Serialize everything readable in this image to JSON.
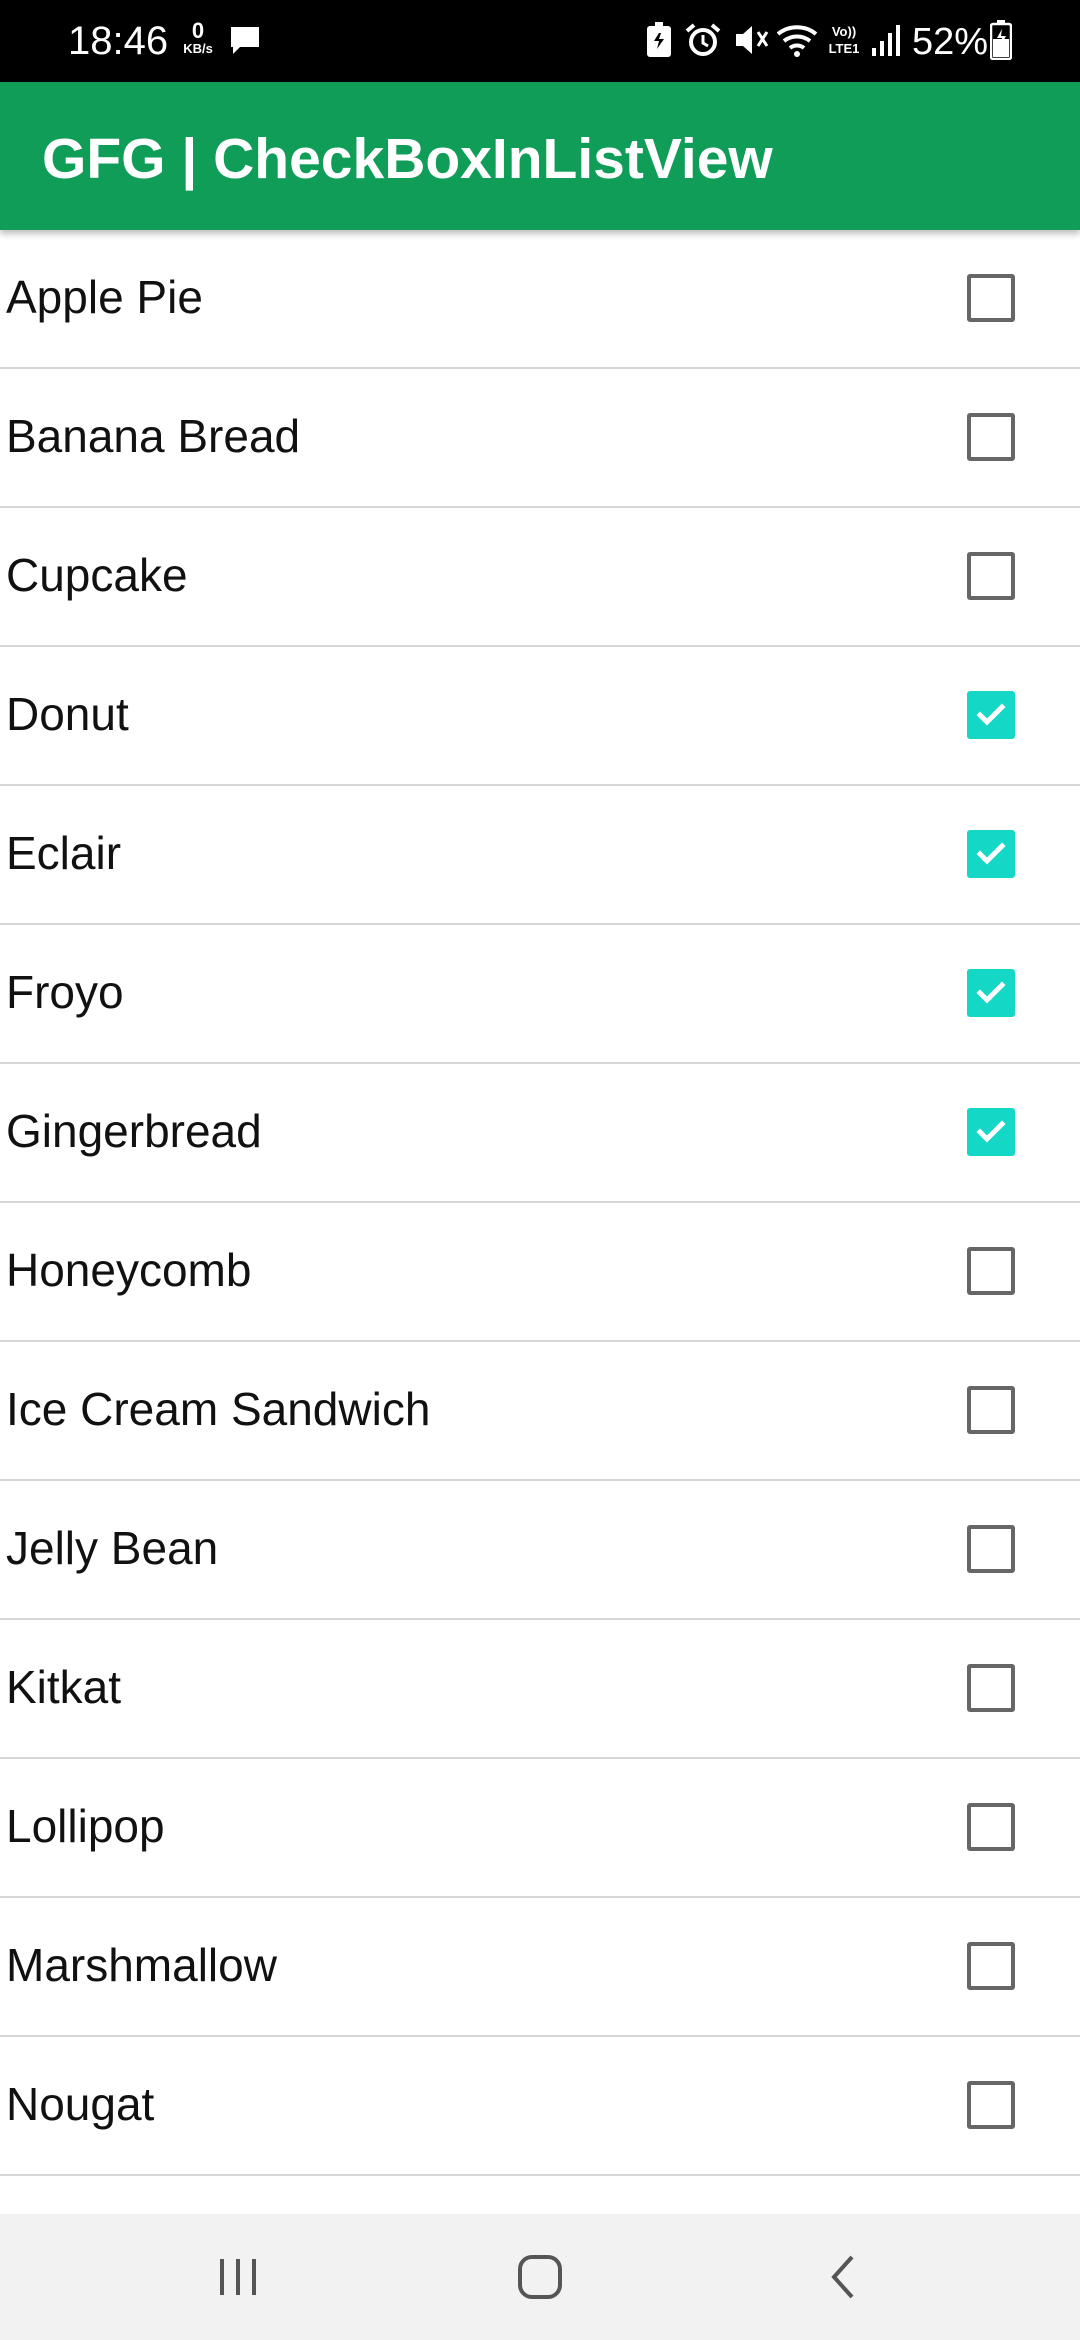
{
  "status_bar": {
    "time": "18:46",
    "net_speed_value": "0",
    "net_speed_unit": "KB/s",
    "battery": "52%",
    "icons": [
      "message-icon",
      "battery-saver-icon",
      "alarm-icon",
      "mute-icon",
      "wifi-icon",
      "volte-icon",
      "signal-icon",
      "battery-icon"
    ]
  },
  "app_bar": {
    "title": "GFG | CheckBoxInListView",
    "color": "#0f9d58"
  },
  "list": {
    "checkbox_checked_color": "#14d7c6",
    "items": [
      {
        "label": "Apple Pie",
        "checked": false
      },
      {
        "label": "Banana Bread",
        "checked": false
      },
      {
        "label": "Cupcake",
        "checked": false
      },
      {
        "label": "Donut",
        "checked": true
      },
      {
        "label": "Eclair",
        "checked": true
      },
      {
        "label": "Froyo",
        "checked": true
      },
      {
        "label": "Gingerbread",
        "checked": true
      },
      {
        "label": "Honeycomb",
        "checked": false
      },
      {
        "label": "Ice Cream Sandwich",
        "checked": false
      },
      {
        "label": "Jelly Bean",
        "checked": false
      },
      {
        "label": "Kitkat",
        "checked": false
      },
      {
        "label": "Lollipop",
        "checked": false
      },
      {
        "label": "Marshmallow",
        "checked": false
      },
      {
        "label": "Nougat",
        "checked": false
      }
    ]
  },
  "nav_bar": {
    "buttons": [
      "recent-apps-icon",
      "home-icon",
      "back-icon"
    ]
  }
}
